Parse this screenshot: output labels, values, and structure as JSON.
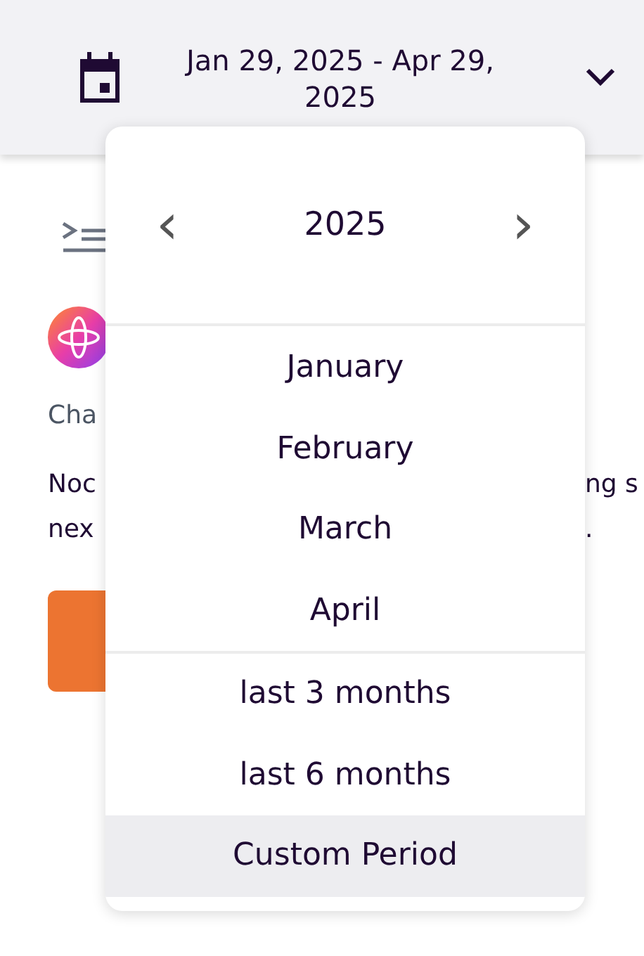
{
  "header": {
    "date_range": "Jan 29, 2025 - Apr 29, 2025"
  },
  "background": {
    "label": "Cha",
    "message_left": [
      "Noc",
      "nex"
    ],
    "message_right": [
      "ng s",
      "."
    ]
  },
  "dropdown": {
    "year": "2025",
    "prev": "‹",
    "next": "›",
    "months": [
      {
        "label": "January",
        "selected": false
      },
      {
        "label": "February",
        "selected": false
      },
      {
        "label": "March",
        "selected": false
      },
      {
        "label": "April",
        "selected": false
      }
    ],
    "periods": [
      {
        "label": "last 3 months",
        "selected": false
      },
      {
        "label": "last 6 months",
        "selected": false
      },
      {
        "label": "Custom Period",
        "selected": true
      }
    ]
  }
}
